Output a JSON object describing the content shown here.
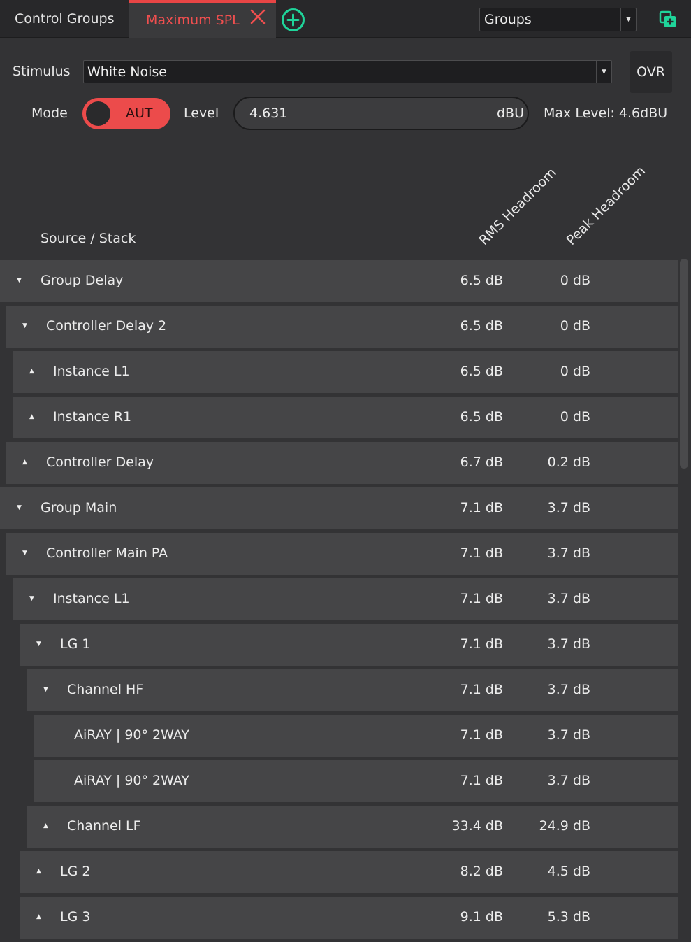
{
  "tabs": {
    "control_groups": "Control Groups",
    "active": "Maximum SPL"
  },
  "view_select": {
    "value": "Groups"
  },
  "stimulus": {
    "label": "Stimulus",
    "value": "White Noise"
  },
  "ovr": {
    "label": "OVR"
  },
  "mode": {
    "label": "Mode",
    "value": "AUT"
  },
  "level": {
    "label": "Level",
    "value": "4.631",
    "unit": "dBU",
    "max": "Max Level: 4.6dBU"
  },
  "columns": {
    "source": "Source / Stack",
    "rms": "RMS Headroom",
    "peak": "Peak Headroom"
  },
  "colors": {
    "accent_red": "#ec4b4b",
    "accent_green": "#1fd49a",
    "row_bg": "#454547",
    "panel_bg": "#333335"
  },
  "rows": [
    {
      "name": "Group Delay",
      "rms": "6.5 dB",
      "peak": "0 dB",
      "expanded": true,
      "level": 0
    },
    {
      "name": "Controller Delay 2",
      "rms": "6.5 dB",
      "peak": "0 dB",
      "expanded": true,
      "level": 1
    },
    {
      "name": "Instance L1",
      "rms": "6.5 dB",
      "peak": "0 dB",
      "expanded": false,
      "level": 2
    },
    {
      "name": "Instance R1",
      "rms": "6.5 dB",
      "peak": "0 dB",
      "expanded": false,
      "level": 2
    },
    {
      "name": "Controller Delay",
      "rms": "6.7 dB",
      "peak": "0.2 dB",
      "expanded": false,
      "level": 1
    },
    {
      "name": "Group Main",
      "rms": "7.1 dB",
      "peak": "3.7 dB",
      "expanded": true,
      "level": 0
    },
    {
      "name": "Controller Main PA",
      "rms": "7.1 dB",
      "peak": "3.7 dB",
      "expanded": true,
      "level": 1
    },
    {
      "name": "Instance L1",
      "rms": "7.1 dB",
      "peak": "3.7 dB",
      "expanded": true,
      "level": 2
    },
    {
      "name": "LG 1",
      "rms": "7.1 dB",
      "peak": "3.7 dB",
      "expanded": true,
      "level": 3
    },
    {
      "name": "Channel HF",
      "rms": "7.1 dB",
      "peak": "3.7 dB",
      "expanded": true,
      "level": 4
    },
    {
      "name": "AiRAY | 90° 2WAY",
      "rms": "7.1 dB",
      "peak": "3.7 dB",
      "expanded": null,
      "level": 5
    },
    {
      "name": "AiRAY | 90° 2WAY",
      "rms": "7.1 dB",
      "peak": "3.7 dB",
      "expanded": null,
      "level": 5
    },
    {
      "name": "Channel LF",
      "rms": "33.4 dB",
      "peak": "24.9 dB",
      "expanded": false,
      "level": 4
    },
    {
      "name": "LG 2",
      "rms": "8.2 dB",
      "peak": "4.5 dB",
      "expanded": false,
      "level": 3
    },
    {
      "name": "LG 3",
      "rms": "9.1 dB",
      "peak": "5.3 dB",
      "expanded": false,
      "level": 3
    }
  ]
}
